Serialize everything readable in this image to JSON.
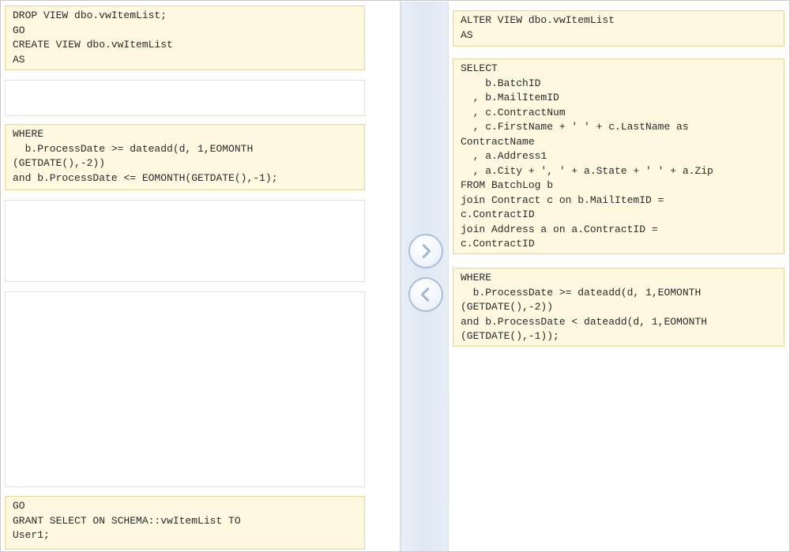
{
  "left": {
    "block1": [
      "DROP VIEW dbo.vwItemList;",
      "GO",
      "CREATE VIEW dbo.vwItemList",
      "AS"
    ],
    "block2": [
      "WHERE",
      "  b.ProcessDate >= dateadd(d, 1,EOMONTH",
      "(GETDATE(),-2))",
      "and b.ProcessDate <= EOMONTH(GETDATE(),-1);"
    ],
    "block3": [
      "GO",
      "GRANT SELECT ON SCHEMA::vwItemList TO",
      "User1;"
    ]
  },
  "right": {
    "block1": [
      "ALTER VIEW dbo.vwItemList",
      "AS"
    ],
    "block2": [
      "SELECT",
      "    b.BatchID",
      "  , b.MailItemID",
      "  , c.ContractNum",
      "  , c.FirstName + ' ' + c.LastName as",
      "ContractName",
      "  , a.Address1",
      "  , a.City + ', ' + a.State + ' ' + a.Zip",
      "FROM BatchLog b",
      "join Contract c on b.MailItemID =",
      "c.ContractID",
      "join Address a on a.ContractID =",
      "c.ContractID"
    ],
    "block3": [
      "WHERE",
      "  b.ProcessDate >= dateadd(d, 1,EOMONTH",
      "(GETDATE(),-2))",
      "and b.ProcessDate < dateadd(d, 1,EOMONTH",
      "(GETDATE(),-1));"
    ]
  },
  "icons": {
    "move_right": "chevron-right-icon",
    "move_left": "chevron-left-icon"
  },
  "colors": {
    "code_bg": "#fdf8df",
    "code_border": "#e7d9a2",
    "arrow_border": "#a9bfd6",
    "arrow_glyph": "#9fb6cf"
  }
}
